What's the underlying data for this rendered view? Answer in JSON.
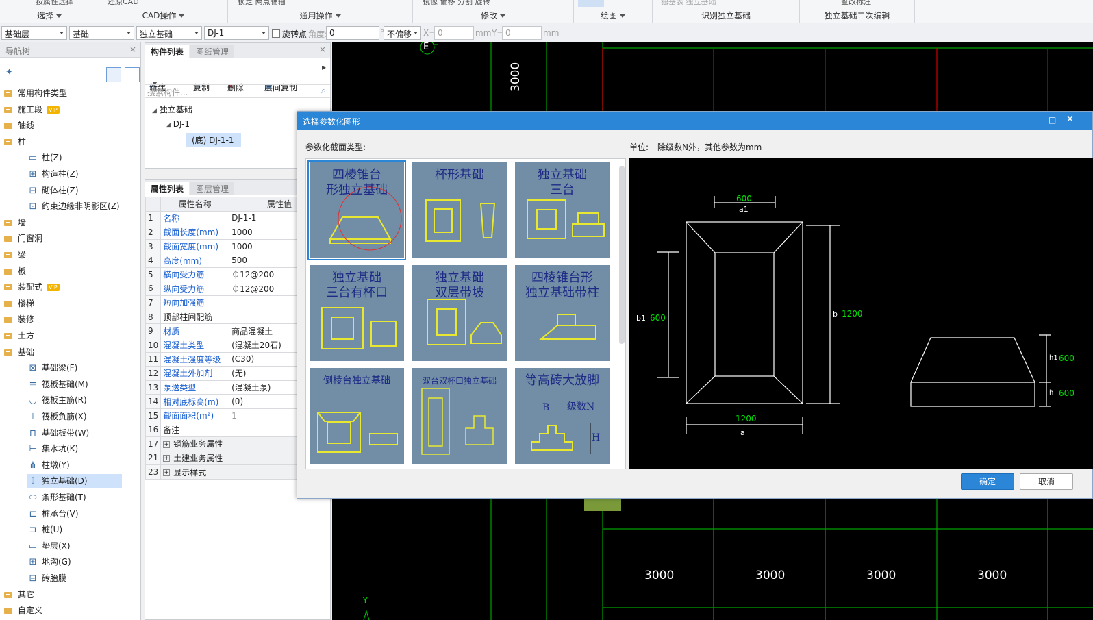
{
  "ribbon": {
    "groups": [
      {
        "label": "选择",
        "item": "按属性选择"
      },
      {
        "label": "CAD操作",
        "item": "还原CAD"
      },
      {
        "label": "通用操作",
        "item": "锁定   两点辅轴"
      },
      {
        "label": "修改",
        "item": "镜像  偏移  分割  旋转"
      },
      {
        "label": "绘图",
        "item": ""
      },
      {
        "label": "识别独立基础",
        "item": "独基表  独立基础"
      },
      {
        "label": "独立基础二次编辑",
        "item": "查改标注"
      }
    ]
  },
  "toolbar2": {
    "floor": "基础层",
    "category": "基础",
    "type": "独立基础",
    "element": "DJ-1",
    "rotate_label": "旋转点",
    "angle_label": "角度:",
    "angle_value": "0",
    "degree": "°",
    "offset": "不偏移",
    "x_label": "X=",
    "x_value": "0",
    "mm1": "mm",
    "y_label": "Y=",
    "y_value": "0",
    "mm2": "mm"
  },
  "nav": {
    "title": "导航树",
    "close": "×",
    "items": [
      {
        "label": "常用构件类型",
        "kind": "folder"
      },
      {
        "label": "施工段",
        "kind": "folder",
        "vip": "VIP"
      },
      {
        "label": "轴线",
        "kind": "folder"
      },
      {
        "label": "柱",
        "kind": "folder"
      },
      {
        "label": "柱(Z)",
        "kind": "child"
      },
      {
        "label": "构造柱(Z)",
        "kind": "child"
      },
      {
        "label": "砌体柱(Z)",
        "kind": "child"
      },
      {
        "label": "约束边缘非阴影区(Z)",
        "kind": "child"
      },
      {
        "label": "墙",
        "kind": "folder"
      },
      {
        "label": "门窗洞",
        "kind": "folder"
      },
      {
        "label": "梁",
        "kind": "folder"
      },
      {
        "label": "板",
        "kind": "folder"
      },
      {
        "label": "装配式",
        "kind": "folder",
        "vip": "VIP"
      },
      {
        "label": "楼梯",
        "kind": "folder"
      },
      {
        "label": "装修",
        "kind": "folder"
      },
      {
        "label": "土方",
        "kind": "folder"
      },
      {
        "label": "基础",
        "kind": "folder"
      },
      {
        "label": "基础梁(F)",
        "kind": "child"
      },
      {
        "label": "筏板基础(M)",
        "kind": "child"
      },
      {
        "label": "筏板主筋(R)",
        "kind": "child"
      },
      {
        "label": "筏板负筋(X)",
        "kind": "child"
      },
      {
        "label": "基础板带(W)",
        "kind": "child"
      },
      {
        "label": "集水坑(K)",
        "kind": "child"
      },
      {
        "label": "柱墩(Y)",
        "kind": "child"
      },
      {
        "label": "独立基础(D)",
        "kind": "child",
        "selected": true
      },
      {
        "label": "条形基础(T)",
        "kind": "child"
      },
      {
        "label": "桩承台(V)",
        "kind": "child"
      },
      {
        "label": "桩(U)",
        "kind": "child"
      },
      {
        "label": "垫层(X)",
        "kind": "child"
      },
      {
        "label": "地沟(G)",
        "kind": "child"
      },
      {
        "label": "砖胎膜",
        "kind": "child"
      },
      {
        "label": "其它",
        "kind": "folder"
      },
      {
        "label": "自定义",
        "kind": "folder"
      }
    ]
  },
  "comp": {
    "tab1": "构件列表",
    "tab2": "图纸管理",
    "close": "×",
    "btn_new": "新建",
    "btn_copy": "复制",
    "btn_delete": "删除",
    "btn_floorcopy": "层间复制",
    "search_placeholder": "搜索构件...",
    "tree": [
      "独立基础",
      "DJ-1",
      "(底)  DJ-1-1"
    ]
  },
  "props": {
    "tab1": "属性列表",
    "tab2": "图层管理",
    "col_name": "属性名称",
    "col_value": "属性值",
    "rows": [
      {
        "n": "1",
        "k": "名称",
        "v": "DJ-1-1",
        "blue": true
      },
      {
        "n": "2",
        "k": "截面长度(mm)",
        "v": "1000",
        "blue": true
      },
      {
        "n": "3",
        "k": "截面宽度(mm)",
        "v": "1000",
        "blue": true
      },
      {
        "n": "4",
        "k": "高度(mm)",
        "v": "500",
        "blue": true
      },
      {
        "n": "5",
        "k": "横向受力筋",
        "v": "⏀12@200",
        "blue": true
      },
      {
        "n": "6",
        "k": "纵向受力筋",
        "v": "⏀12@200",
        "blue": true
      },
      {
        "n": "7",
        "k": "短向加强筋",
        "v": "",
        "blue": true
      },
      {
        "n": "8",
        "k": "顶部柱间配筋",
        "v": "",
        "blue": false
      },
      {
        "n": "9",
        "k": "材质",
        "v": "商品混凝土",
        "blue": true
      },
      {
        "n": "10",
        "k": "混凝土类型",
        "v": "(混凝土20石)",
        "blue": true
      },
      {
        "n": "11",
        "k": "混凝土强度等级",
        "v": "(C30)",
        "blue": true
      },
      {
        "n": "12",
        "k": "混凝土外加剂",
        "v": "(无)",
        "blue": true
      },
      {
        "n": "13",
        "k": "泵送类型",
        "v": "(混凝土泵)",
        "blue": true
      },
      {
        "n": "14",
        "k": "相对底标高(m)",
        "v": "(0)",
        "blue": true
      },
      {
        "n": "15",
        "k": "截面面积(m²)",
        "v": "1",
        "blue": true,
        "gray": true
      },
      {
        "n": "16",
        "k": "备注",
        "v": "",
        "blue": false
      },
      {
        "n": "17",
        "k": "钢筋业务属性",
        "v": "",
        "group": true
      },
      {
        "n": "21",
        "k": "土建业务属性",
        "v": "",
        "group": true
      },
      {
        "n": "23",
        "k": "显示样式",
        "v": "",
        "group": true
      }
    ]
  },
  "cad": {
    "axis_e": "E",
    "dim_vertical": "3000",
    "dims": [
      "3000",
      "3000",
      "3000",
      "3000"
    ],
    "y_axis": "Y"
  },
  "dialog": {
    "title": "选择参数化图形",
    "section_label": "参数化截面类型:",
    "unit_label": "单位:",
    "unit_text": "除级数N外，其他参数为mm",
    "ok": "确定",
    "cancel": "取消",
    "tiles": [
      {
        "title": "四棱锥台形独立基础",
        "lines": [
          "四棱锥台",
          "形独立基础"
        ]
      },
      {
        "title": "杯形基础",
        "lines": [
          "杯形基础"
        ]
      },
      {
        "title": "独立基础三台",
        "lines": [
          "独立基础",
          "三台"
        ]
      },
      {
        "title": "独立基础三台有杯口",
        "lines": [
          "独立基础",
          "三台有杯口"
        ]
      },
      {
        "title": "独立基础双层带坡",
        "lines": [
          "独立基础",
          "双层带坡"
        ]
      },
      {
        "title": "四棱锥台形独立基础带柱",
        "lines": [
          "四棱锥台形",
          "独立基础带柱"
        ]
      },
      {
        "title": "倒棱台独立基础",
        "lines": [
          "倒棱台独立基础"
        ]
      },
      {
        "title": "双台双杯口独立基础",
        "lines": [
          "双台双杯口独立基础"
        ]
      },
      {
        "title": "等高砖大放脚",
        "lines": [
          "等高砖大放脚"
        ],
        "extra": [
          "B",
          "级数N",
          "H"
        ]
      }
    ],
    "preview": {
      "top_dim": "600",
      "top_sub": "a1",
      "left_dim_label": "b1",
      "left_dim": "600",
      "right_dim_label": "b",
      "right_dim": "1200",
      "bottom_dim": "1200",
      "bottom_sub": "a",
      "h1_label": "h1",
      "h1": "600",
      "h_label": "h",
      "h": "600"
    }
  },
  "colors": {
    "title_bar": "#2b86d8",
    "tile_bg": "#718ea6",
    "cad_bg": "#000000",
    "grid_red": "#d00000",
    "grid_green": "#00b000",
    "dim_green": "#00e000"
  }
}
